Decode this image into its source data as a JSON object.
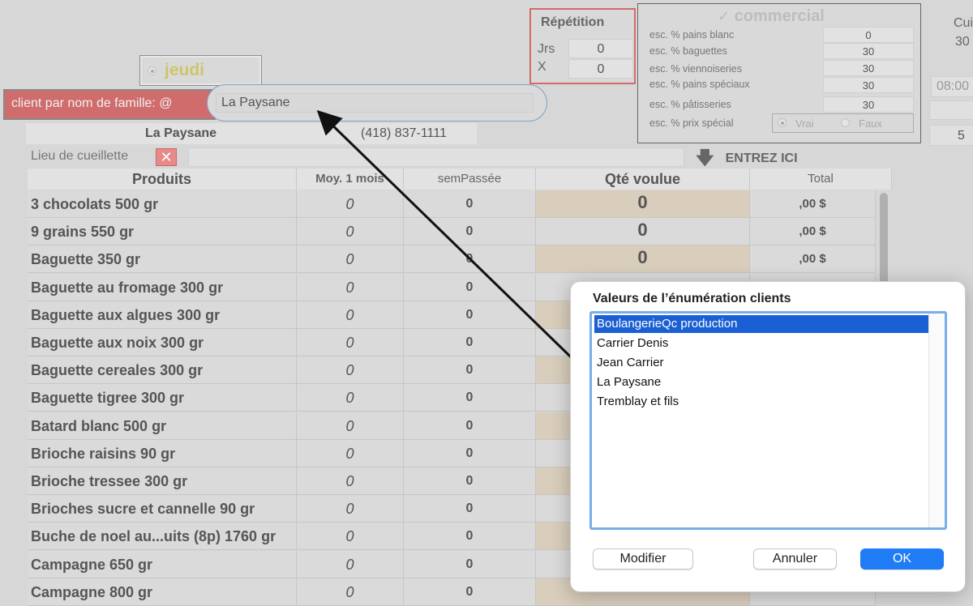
{
  "repetition": {
    "title": "Répétition",
    "jrs_label": "Jrs",
    "jrs_value": "0",
    "x_label": "X",
    "x_value": "0"
  },
  "commercial": {
    "title": "commercial",
    "rows": [
      {
        "label": "esc. % pains blanc",
        "value": "0"
      },
      {
        "label": "esc. % baguettes",
        "value": "30"
      },
      {
        "label": "esc. % viennoiseries",
        "value": "30"
      },
      {
        "label": "esc. % pains spéciaux",
        "value": "30"
      },
      {
        "label": "esc. % pâtisseries",
        "value": "30"
      }
    ],
    "prix_label": "esc. % prix spécial",
    "vrai": "Vrai",
    "faux": "Faux"
  },
  "edge": {
    "cu": "Cui",
    "v30": "30",
    "time": "08:00",
    "five": "5"
  },
  "jeudi": "jeudi",
  "client": {
    "label": "client  par nom de famille: @",
    "value": "La Paysane",
    "name": "La Paysane",
    "phone": "(418) 837-1111"
  },
  "lieu": {
    "label": "Lieu de cueillette",
    "close": "✕"
  },
  "entrez": {
    "arrow": "🡇",
    "label": "ENTREZ ICI"
  },
  "table": {
    "headers": {
      "produits": "Produits",
      "moy": "Moy. 1 mois",
      "sem": "semPassée",
      "qte": "Qté voulue",
      "total": "Total"
    },
    "rows": [
      {
        "name": "3 chocolats 500 gr",
        "moy": "0",
        "sem": "0",
        "qte": "0",
        "total": ",00 $"
      },
      {
        "name": "9 grains 550 gr",
        "moy": "0",
        "sem": "0",
        "qte": "0",
        "total": ",00 $"
      },
      {
        "name": "Baguette 350 gr",
        "moy": "0",
        "sem": "0",
        "qte": "0",
        "total": ",00 $"
      },
      {
        "name": "Baguette au fromage 300 gr",
        "moy": "0",
        "sem": "0"
      },
      {
        "name": "Baguette aux algues 300 gr",
        "moy": "0",
        "sem": "0"
      },
      {
        "name": "Baguette aux noix 300 gr",
        "moy": "0",
        "sem": "0"
      },
      {
        "name": "Baguette cereales 300 gr",
        "moy": "0",
        "sem": "0"
      },
      {
        "name": "Baguette tigree 300 gr",
        "moy": "0",
        "sem": "0"
      },
      {
        "name": "Batard blanc 500 gr",
        "moy": "0",
        "sem": "0"
      },
      {
        "name": "Brioche raisins 90 gr",
        "moy": "0",
        "sem": "0"
      },
      {
        "name": "Brioche tressee 300 gr",
        "moy": "0",
        "sem": "0"
      },
      {
        "name": "Brioches sucre et cannelle 90 gr",
        "moy": "0",
        "sem": "0"
      },
      {
        "name": "Buche de noel au...uits (8p) 1760 gr",
        "moy": "0",
        "sem": "0"
      },
      {
        "name": "Campagne 650 gr",
        "moy": "0",
        "sem": "0"
      },
      {
        "name": "Campagne 800 gr",
        "moy": "0",
        "sem": "0"
      }
    ]
  },
  "dialog": {
    "title": "Valeurs de l’énumération clients",
    "items": [
      "BoulangerieQc production",
      "Carrier Denis",
      "Jean Carrier",
      "La Paysane",
      "Tremblay et fils"
    ],
    "selected_index": 0,
    "buttons": {
      "modifier": "Modifier",
      "annuler": "Annuler",
      "ok": "OK"
    }
  }
}
